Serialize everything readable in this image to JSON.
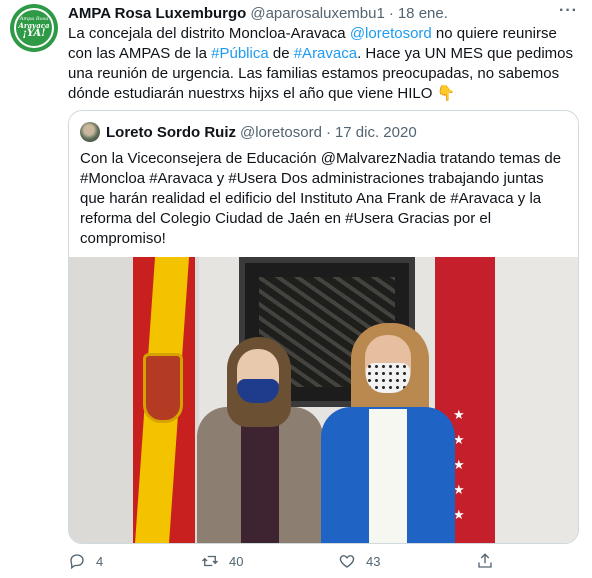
{
  "tweet": {
    "avatar_lines": [
      "Ampa Rosa",
      "Aravaca",
      "¡YA!"
    ],
    "display_name": "AMPA Rosa Luxemburgo",
    "handle": "@aparosaluxembu1",
    "separator": "·",
    "date": "18 ene.",
    "text_parts": [
      "La concejala del distrito Moncloa-Aravaca ",
      "@loretosord",
      " no quiere reunirse con las AMPAS de la ",
      "#Pública",
      " de ",
      "#Aravaca",
      ".  Hace ya UN MES que pedimos una reunión de urgencia. Las familias estamos preocupadas, no sabemos dónde estudiarán nuestrxs hijxs el año que viene HILO 👇"
    ],
    "more_icon": "more-horizontal-icon"
  },
  "quoted": {
    "display_name": "Loreto Sordo Ruiz",
    "handle": "@loretosord",
    "separator": "·",
    "date": "17 dic. 2020",
    "text": "Con la Viceconsejera de Educación @MalvarezNadia tratando temas de #Moncloa #Aravaca y #Usera Dos administraciones trabajando juntas que harán realidad el edificio del Instituto Ana Frank de #Aravaca y la reforma del Colegio Ciudad de Jaén en #Usera Gracias por el compromiso!"
  },
  "actions": {
    "reply_count": "4",
    "retweet_count": "40",
    "like_count": "43",
    "icons": [
      "reply-icon",
      "retweet-icon",
      "like-icon",
      "share-icon"
    ]
  },
  "colors": {
    "link": "#1d9bf0",
    "text": "#0f1419",
    "muted": "#536471",
    "border": "#cfd9de",
    "avatar_green": "#2f9a45"
  }
}
